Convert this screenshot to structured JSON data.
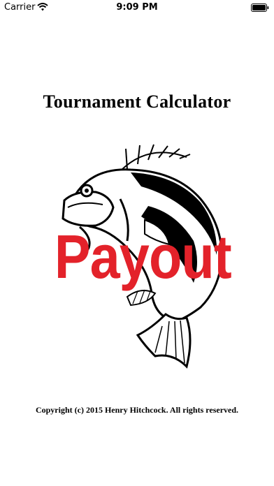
{
  "status_bar": {
    "carrier": "Carrier",
    "time": "9:09 PM",
    "wifi_icon": "wifi-icon",
    "battery_icon": "battery-icon"
  },
  "splash": {
    "title": "Tournament Calculator",
    "logo_word": "Payout",
    "logo_icon": "bass-fish-icon",
    "copyright": "Copyright (c) 2015 Henry Hitchcock. All rights reserved.",
    "accent_color": "#e3222a"
  }
}
